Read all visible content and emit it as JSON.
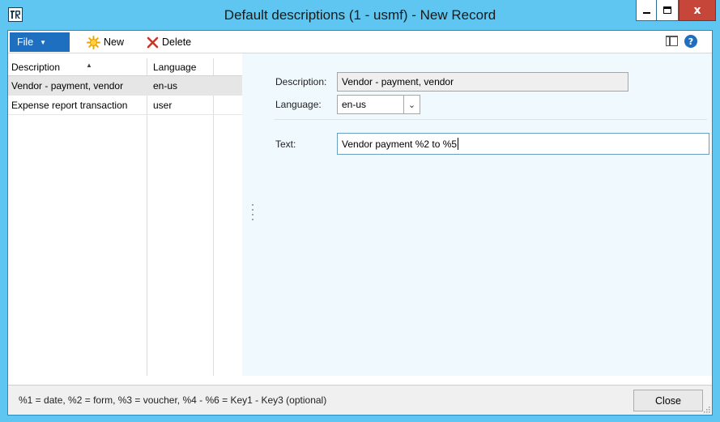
{
  "window": {
    "title": "Default descriptions (1 - usmf) - New Record",
    "min_glyph": "–",
    "max_glyph": "□",
    "close_glyph": "x"
  },
  "toolbar": {
    "file_label": "File",
    "new_label": "New",
    "delete_label": "Delete"
  },
  "grid": {
    "columns": [
      "Description",
      "Language"
    ],
    "rows": [
      {
        "description": "Vendor - payment, vendor",
        "language": "en-us",
        "selected": true
      },
      {
        "description": "Expense report transaction",
        "language": "user",
        "selected": false
      }
    ]
  },
  "detail": {
    "description_label": "Description:",
    "description_value": "Vendor - payment, vendor",
    "language_label": "Language:",
    "language_value": "en-us",
    "text_label": "Text:",
    "text_value": "Vendor payment %2 to %5"
  },
  "status": {
    "hint": "%1 = date, %2 = form, %3 = voucher, %4 - %6 = Key1 - Key3 (optional)",
    "close_label": "Close"
  },
  "colors": {
    "titlebar": "#5ec6f0",
    "file_button": "#1e6fc0",
    "close_window": "#c7463a",
    "detail_bg": "#f0f9fe"
  },
  "icons": [
    "app-icon",
    "minimize-icon",
    "maximize-icon",
    "close-icon",
    "caret-down-icon",
    "new-star-icon",
    "delete-x-icon",
    "layout-icon",
    "help-icon",
    "sort-ascending-icon",
    "dropdown-chevron-icon",
    "splitter-handle-icon",
    "resize-grip-icon"
  ]
}
